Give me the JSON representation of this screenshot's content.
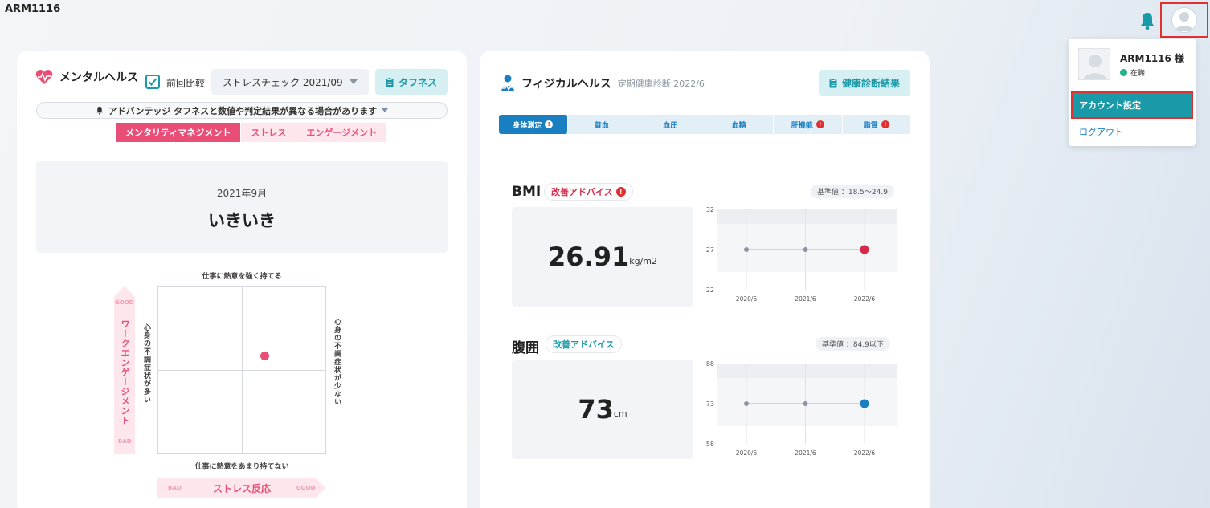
{
  "header": {
    "app_id": "ARM1116"
  },
  "mental": {
    "title": "メンタルヘルス",
    "compare_label": "前回比較",
    "select_value": "ストレスチェック 2021/09",
    "toughness_btn": "タフネス",
    "notice": "アドバンテッジ タフネスと数値や判定結果が異なる場合があります",
    "tabs": [
      {
        "label": "メンタリティマネジメント",
        "active": true
      },
      {
        "label": "ストレス",
        "active": false
      },
      {
        "label": "エンゲージメント",
        "active": false
      }
    ],
    "result_date": "2021年9月",
    "result_word": "いきいき",
    "quad": {
      "top_label": "仕事に熱意を強く持てる",
      "bottom_label": "仕事に熱意をあまり持てない",
      "left_label": "心身の不調症状が多い",
      "right_label": "心身の不調症状が少ない",
      "y_axis": "ワークエンゲージメント",
      "x_axis": "ストレス反応",
      "good": "GOOD",
      "bad": "BAD"
    }
  },
  "physical": {
    "title": "フィジカルヘルス",
    "subtitle": "定期健康診断 2022/6",
    "exam_btn": "健康診断結果",
    "tabs": [
      {
        "label": "身体測定",
        "active": true,
        "alert": true
      },
      {
        "label": "貧血",
        "active": false,
        "alert": false
      },
      {
        "label": "血圧",
        "active": false,
        "alert": false
      },
      {
        "label": "血糖",
        "active": false,
        "alert": false
      },
      {
        "label": "肝機能",
        "active": false,
        "alert": true
      },
      {
        "label": "脂質",
        "active": false,
        "alert": true
      }
    ],
    "bmi": {
      "title": "BMI",
      "advice": "改善アドバイス",
      "advice_color": "#d6294a",
      "reference": "基準値 ：18.5～24.9",
      "value": "26.91",
      "unit": "kg/m2"
    },
    "waist": {
      "title": "腹囲",
      "advice": "改善アドバイス",
      "advice_color": "#1a9aa8",
      "reference": "基準値 ：84.9以下",
      "value": "73",
      "unit": "cm"
    }
  },
  "chart_data": [
    {
      "type": "line",
      "name": "BMI",
      "x": [
        "2020/6",
        "2021/6",
        "2022/6"
      ],
      "y": [
        27,
        27,
        27
      ],
      "yticks": [
        "32",
        "27",
        "22"
      ],
      "ylim": [
        22,
        32
      ],
      "highlight_color": "#d6294a"
    },
    {
      "type": "line",
      "name": "腹囲",
      "x": [
        "2020/6",
        "2021/6",
        "2022/6"
      ],
      "y": [
        73,
        73,
        73
      ],
      "yticks": [
        "88",
        "73",
        "58"
      ],
      "ylim": [
        58,
        88
      ],
      "highlight_color": "#1a7fc1"
    }
  ],
  "popup": {
    "name": "ARM1116 様",
    "status": "在職",
    "account_settings": "アカウント設定",
    "logout": "ログアウト"
  }
}
